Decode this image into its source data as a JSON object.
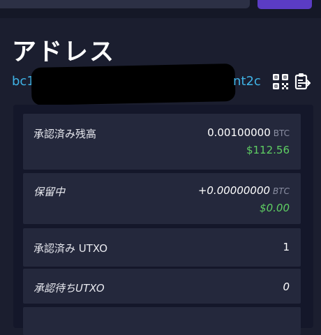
{
  "header": {
    "title": "アドレス"
  },
  "address": {
    "prefix": "bc1",
    "suffix": "nt2c"
  },
  "rows": {
    "confirmed_balance": {
      "label": "承認済み残高",
      "btc": "0.00100000",
      "unit": "BTC",
      "fiat": "$112.56"
    },
    "pending": {
      "label": "保留中",
      "btc": "+0.00000000",
      "unit": "BTC",
      "fiat": "$0.00"
    },
    "confirmed_utxo": {
      "label": "承認済み UTXO",
      "value": "1"
    },
    "pending_utxo": {
      "label": "承認待ちUTXO",
      "value": "0"
    }
  },
  "colors": {
    "accent": "#5b3cc4",
    "address": "#3fb3e6",
    "fiat_positive": "#5fcf63"
  },
  "icons": [
    "qr-code-icon",
    "copy-icon"
  ]
}
